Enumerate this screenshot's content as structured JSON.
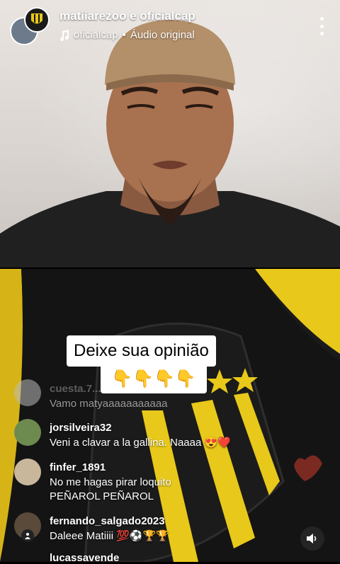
{
  "header": {
    "usernames": "matiiarezoo e oficialcap",
    "audio_owner": "oficialcap",
    "audio_sep": "•",
    "audio_label": "Áudio original"
  },
  "caption": {
    "line1": "Deixe sua opinião",
    "emojis": "👇👇👇👇"
  },
  "comments": [
    {
      "user": "cuesta.7...",
      "lines": [
        "Vamo matyaaaaaaaaaaa"
      ]
    },
    {
      "user": "jorsilveira32",
      "lines": [
        "Veni a clavar a la gallina. Naaaa 😍❤️"
      ]
    },
    {
      "user": "finfer_1891",
      "lines": [
        "No me hagas pirar loquito",
        "PEÑAROL PEÑAROL"
      ]
    },
    {
      "user": "fernando_salgado2023",
      "lines": [
        "Daleee Matiiii 💯⚽🏆🏆"
      ]
    },
    {
      "user": "lucassavende",
      "lines": []
    }
  ],
  "colors": {
    "jersey_yellow": "#e8c81a",
    "jersey_black": "#141414"
  },
  "icons": {
    "music": "music-note-icon",
    "more": "more-vertical-icon",
    "speaker": "speaker-icon"
  }
}
